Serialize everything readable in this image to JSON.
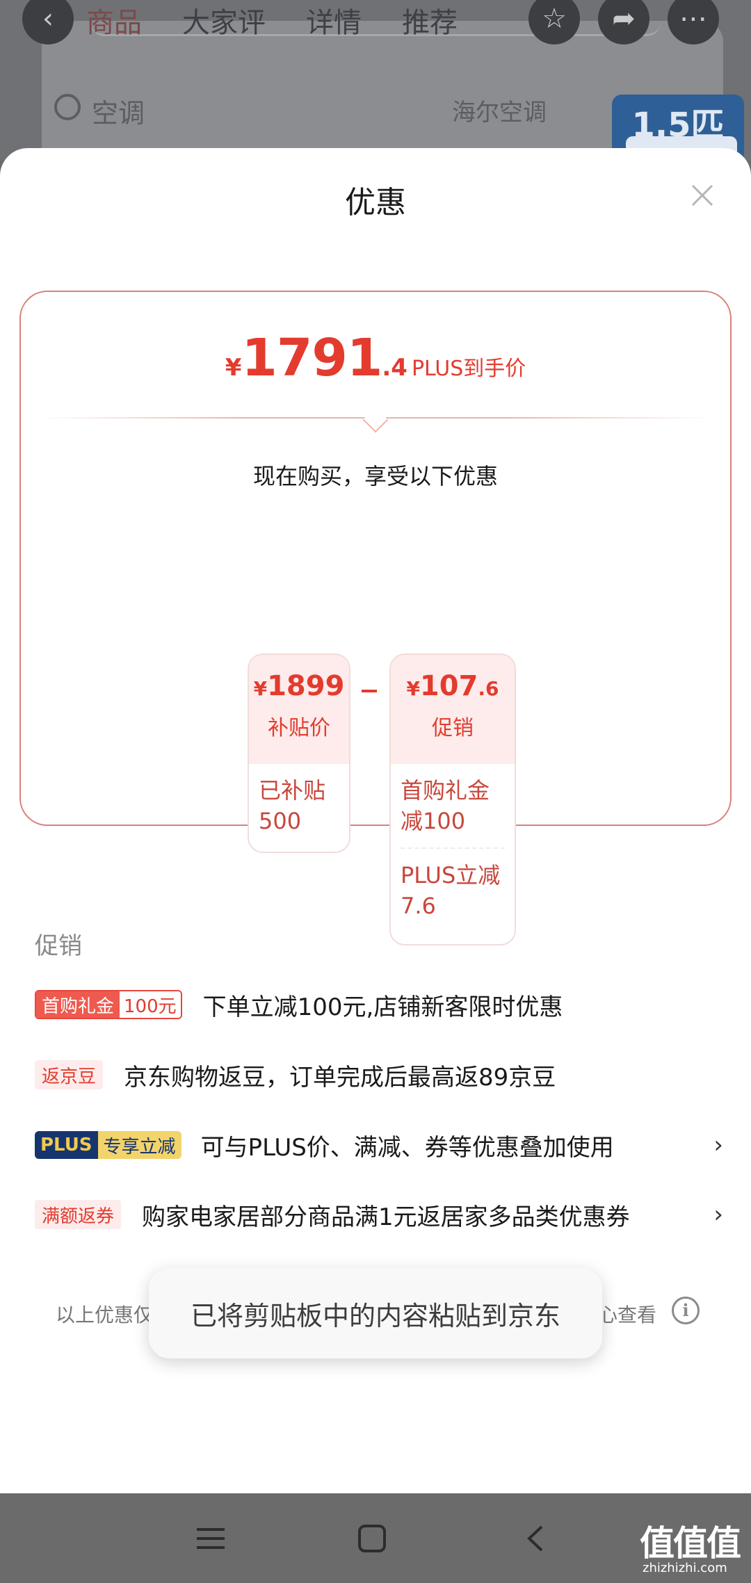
{
  "background": {
    "tabs": [
      "商品",
      "大家评",
      "详情",
      "推荐"
    ],
    "search_text": "空调",
    "suggest_text": "海尔空调",
    "badge_text": "1.5匹"
  },
  "sheet": {
    "title": "优惠",
    "price": {
      "currency": "¥",
      "integer": "1791",
      "decimal": ".4",
      "label": "PLUS到手价"
    },
    "enjoy_text": "现在购买，享受以下优惠",
    "breakdown": {
      "subsidy": {
        "currency": "¥",
        "amount": "1899",
        "type": "补贴价",
        "detail": "已补贴500"
      },
      "promo": {
        "currency": "¥",
        "amount_int": "107",
        "amount_dec": ".6",
        "type": "促销",
        "details": [
          "首购礼金减100",
          "PLUS立减7.6"
        ]
      }
    },
    "promotions_heading": "促销",
    "promotions": [
      {
        "tag": "首购礼金",
        "tag_extra": "100元",
        "text": "下单立减100元,店铺新客限时优惠"
      },
      {
        "tag": "返京豆",
        "text": "京东购物返豆，订单完成后最高返89京豆"
      },
      {
        "tag": "PLUS",
        "tag_extra": "专享立减",
        "text": "可与PLUS价、满减、券等优惠叠加使用",
        "arrow": "›"
      },
      {
        "tag": "满额返券",
        "text": "购家电家居部分商品满1元返居家多品类优惠券",
        "arrow": "›"
      }
    ],
    "footer_left": "以上优惠仅",
    "footer_right": "心查看",
    "toast": "已将剪贴板中的内容粘贴到京东"
  },
  "watermark": {
    "main": "值值值",
    "sub": "zhizhizhi.com"
  },
  "colors": {
    "accent": "#e33b2e",
    "plus_navy": "#16356e",
    "plus_gold": "#f3d36b"
  }
}
